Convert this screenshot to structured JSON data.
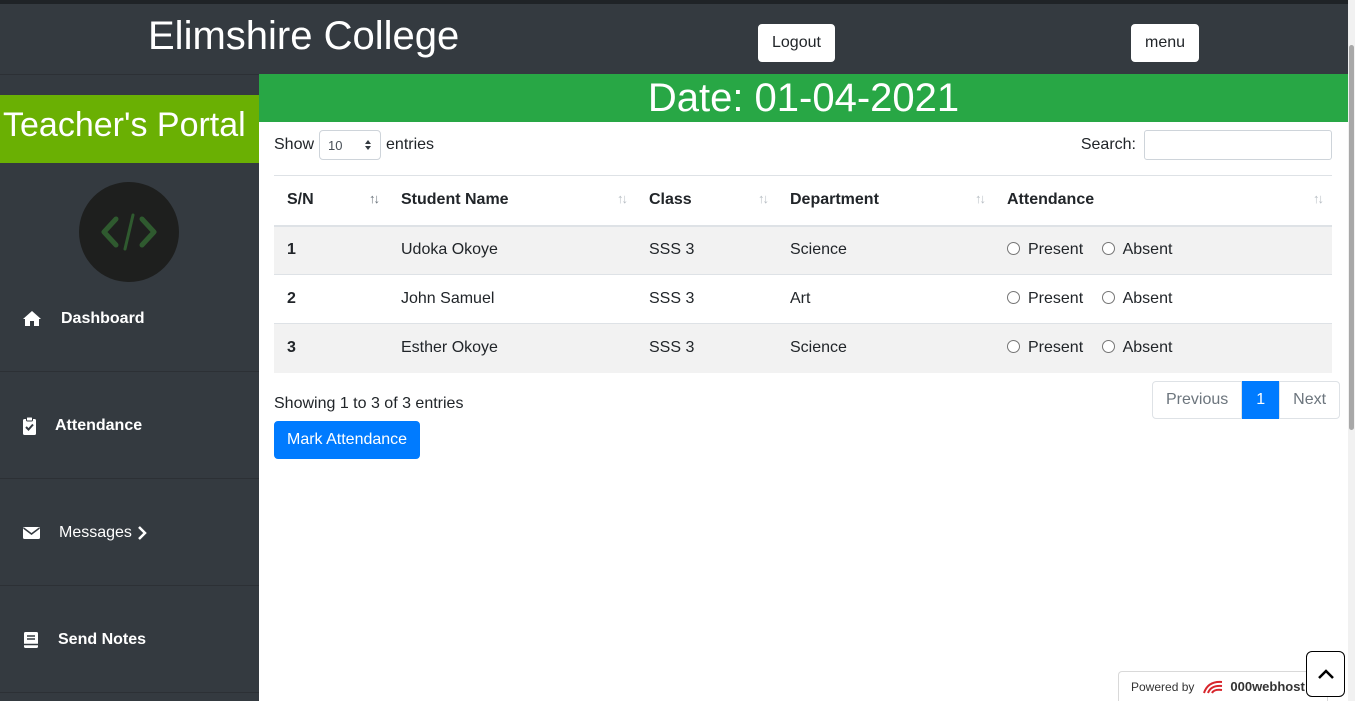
{
  "header": {
    "brand": "Elimshire College",
    "logout_label": "Logout",
    "menu_label": "menu"
  },
  "sidebar": {
    "portal_title": "Teacher's Portal",
    "avatar_icon": "code-icon",
    "items": [
      {
        "label": "Dashboard",
        "icon": "home-icon"
      },
      {
        "label": "Attendance",
        "icon": "clipboard-check-icon"
      },
      {
        "label": "Messages",
        "icon": "envelope-icon"
      },
      {
        "label": "Send Notes",
        "icon": "book-icon"
      }
    ]
  },
  "main": {
    "date_title": "Date: 01-04-2021",
    "show_label": "Show",
    "entries_label": "entries",
    "page_length": "10",
    "search_label": "Search:",
    "search_value": "",
    "columns": [
      "S/N",
      "Student Name",
      "Class",
      "Department",
      "Attendance"
    ],
    "rows": [
      {
        "sn": "1",
        "name": "Udoka Okoye",
        "class": "SSS 3",
        "department": "Science"
      },
      {
        "sn": "2",
        "name": "John Samuel",
        "class": "SSS 3",
        "department": "Art"
      },
      {
        "sn": "3",
        "name": "Esther Okoye",
        "class": "SSS 3",
        "department": "Science"
      }
    ],
    "attendance_options": [
      "Present",
      "Absent"
    ],
    "info": "Showing 1 to 3 of 3 entries",
    "pagination": {
      "previous": "Previous",
      "current": "1",
      "next": "Next"
    },
    "mark_button": "Mark Attendance"
  },
  "footer": {
    "powered_by": "Powered by",
    "host": "000webhost"
  },
  "colors": {
    "dark": "#343a40",
    "green_banner": "#28a745",
    "portal_green": "#6ab003",
    "primary": "#007bff"
  }
}
